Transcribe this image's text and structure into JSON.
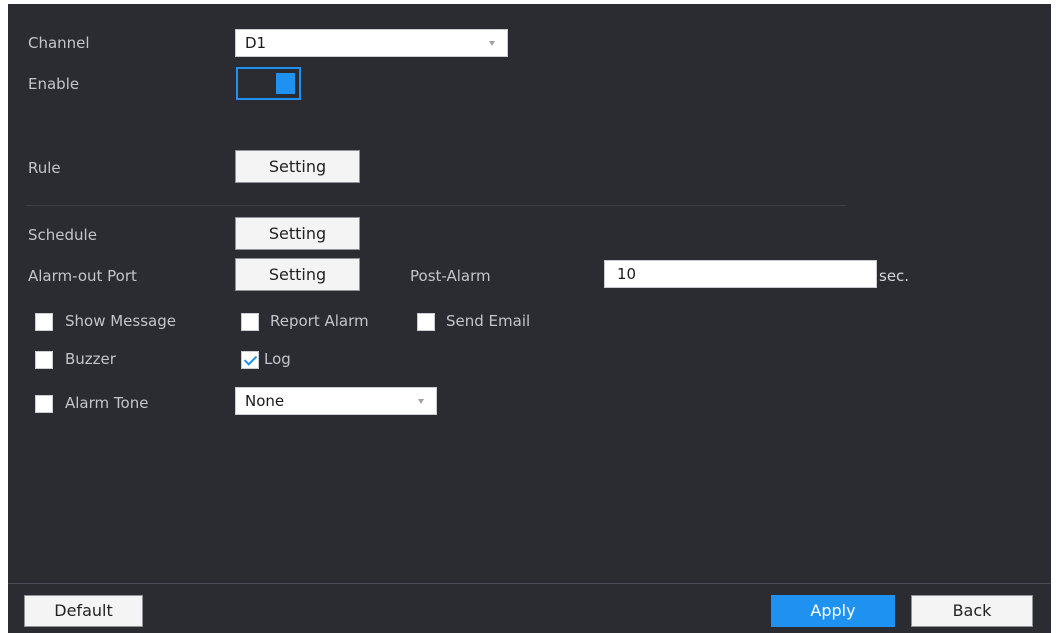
{
  "form": {
    "channel": {
      "label": "Channel",
      "value": "D1"
    },
    "enable": {
      "label": "Enable",
      "state": "on"
    },
    "rule": {
      "label": "Rule",
      "button": "Setting"
    },
    "schedule": {
      "label": "Schedule",
      "button": "Setting"
    },
    "alarm_out": {
      "label": "Alarm-out Port",
      "button": "Setting"
    },
    "post_alarm": {
      "label": "Post-Alarm",
      "value": "10",
      "unit": "sec."
    },
    "checkboxes": {
      "show_message": {
        "label": "Show Message",
        "checked": false
      },
      "report_alarm": {
        "label": "Report Alarm",
        "checked": false
      },
      "send_email": {
        "label": "Send Email",
        "checked": false
      },
      "buzzer": {
        "label": "Buzzer",
        "checked": false
      },
      "log": {
        "label": "Log",
        "checked": true
      },
      "alarm_tone": {
        "label": "Alarm Tone",
        "checked": false
      }
    },
    "alarm_tone_select": {
      "value": "None"
    }
  },
  "footer": {
    "default_label": "Default",
    "apply_label": "Apply",
    "back_label": "Back"
  },
  "colors": {
    "panel_bg": "#2a2c32",
    "accent": "#1f91f0"
  }
}
